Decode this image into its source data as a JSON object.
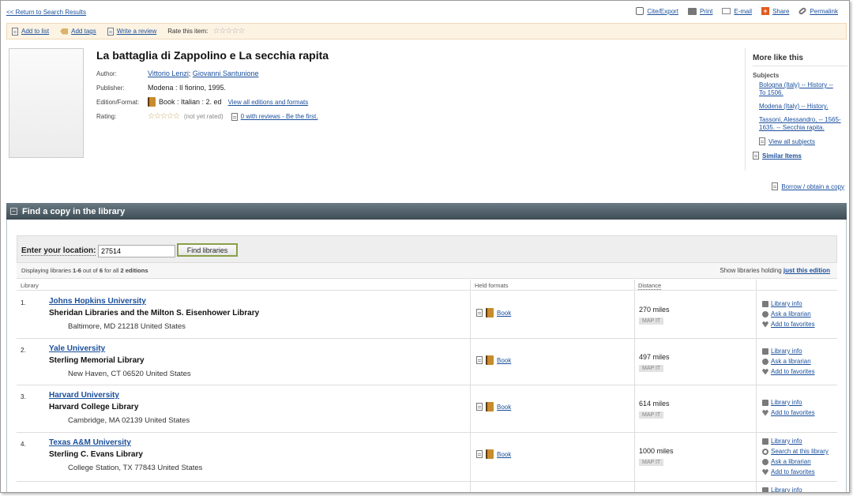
{
  "top": {
    "back_link": "<< Return to Search Results",
    "actions": [
      {
        "label": "Cite/Export",
        "icon": "cite-icon"
      },
      {
        "label": "Print",
        "icon": "print-icon"
      },
      {
        "label": "E-mail",
        "icon": "email-icon"
      },
      {
        "label": "Share",
        "icon": "share-icon"
      },
      {
        "label": "Permalink",
        "icon": "link-icon"
      }
    ]
  },
  "toolbar": {
    "add_to_list": "Add to list",
    "add_tags": "Add tags",
    "write_review": "Write a review",
    "rate_label": "Rate this item:",
    "rate_stars": "☆☆☆☆☆"
  },
  "record": {
    "title": "La battaglia di Zappolino e La secchia rapita",
    "author_label": "Author:",
    "authors": [
      "Vittorio Lenzi",
      "Giovanni Santunione"
    ],
    "author_sep": ";",
    "publisher_label": "Publisher:",
    "publisher": "Modena : Il fiorino, 1995.",
    "edition_label": "Edition/Format:",
    "edition": "Book : Italian : 2. ed",
    "editions_link": "View all editions and formats",
    "rating_label": "Rating:",
    "rating_stars": "☆☆☆☆☆",
    "rating_note": "(not yet rated)",
    "reviews_link": "0 with reviews - Be the first."
  },
  "sidebar": {
    "heading": "More like this",
    "subjects_label": "Subjects",
    "subjects": [
      "Bologna (Italy) -- History -- To 1506.",
      "Modena (Italy) -- History.",
      "Tassoni, Alessandro, -- 1565-1635. -- Secchia rapita."
    ],
    "view_all_subjects": "View all subjects",
    "similar_items": "Similar Items"
  },
  "borrow_link": "Borrow / obtain a copy",
  "find": {
    "header_toggle": "−",
    "header": "Find a copy in the library",
    "location_label": "Enter your location:",
    "location_value": "27514",
    "find_button": "Find libraries",
    "displaying_pre": "Displaying libraries ",
    "displaying_range": "1-6",
    "displaying_mid": " out of ",
    "displaying_total": "6",
    "displaying_post": " for all ",
    "displaying_editions": "2 editions",
    "show_holding_label": "Show libraries holding",
    "just_this_edition": "just this edition",
    "columns": {
      "library": "Library",
      "formats": "Held formats",
      "distance": "Distance"
    }
  },
  "libraries": [
    {
      "num": "1.",
      "name": "Johns Hopkins University",
      "branch": "Sheridan Libraries and the Milton S. Eisenhower Library",
      "address": "Baltimore, MD 21218 United States",
      "format": "Book",
      "distance": "270 miles",
      "map": "MAP IT",
      "actions": [
        "Library info",
        "Ask a librarian",
        "Add to favorites"
      ]
    },
    {
      "num": "2.",
      "name": "Yale University",
      "branch": "Sterling Memorial Library",
      "address": "New Haven, CT 06520 United States",
      "format": "Book",
      "distance": "497 miles",
      "map": "MAP IT",
      "actions": [
        "Library info",
        "Ask a librarian",
        "Add to favorites"
      ]
    },
    {
      "num": "3.",
      "name": "Harvard University",
      "branch": "Harvard College Library",
      "address": "Cambridge, MA 02139 United States",
      "format": "Book",
      "distance": "614 miles",
      "map": "MAP IT",
      "actions": [
        "Library info",
        "Add to favorites"
      ]
    },
    {
      "num": "4.",
      "name": "Texas A&M University",
      "branch": "Sterling C. Evans Library",
      "address": "College Station, TX 77843 United States",
      "format": "Book",
      "distance": "1000 miles",
      "map": "MAP IT",
      "actions": [
        "Library info",
        "Search at this library",
        "Ask a librarian",
        "Add to favorites"
      ]
    },
    {
      "num": "",
      "name": "",
      "branch": "",
      "address": "",
      "format": "",
      "distance": "",
      "map": "",
      "actions": [
        "Library info"
      ]
    }
  ]
}
